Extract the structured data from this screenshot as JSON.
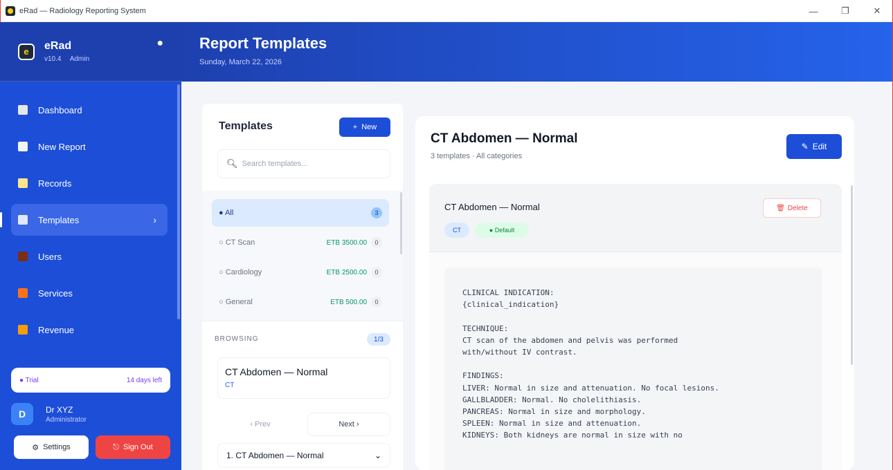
{
  "window": {
    "title": "eRad — Radiology Reporting System",
    "controls": {
      "minimize": "—",
      "maximize": "❐",
      "close": "✕"
    }
  },
  "sidebar": {
    "app_name": "eRad",
    "version": "v10.4",
    "role": "Admin",
    "items": [
      {
        "label": "Dashboard",
        "icon": "dashboard-icon",
        "color": "#e5e7eb"
      },
      {
        "label": "New Report",
        "icon": "new-report-icon",
        "color": "#f3f4f6"
      },
      {
        "label": "Records",
        "icon": "records-icon",
        "color": "#fde68a"
      },
      {
        "label": "Templates",
        "icon": "templates-icon",
        "color": "#e0e7ff",
        "active": true
      },
      {
        "label": "Users",
        "icon": "users-icon",
        "color": "#7c2d12"
      },
      {
        "label": "Services",
        "icon": "services-icon",
        "color": "#f97316"
      },
      {
        "label": "Revenue",
        "icon": "revenue-icon",
        "color": "#f59e0b"
      }
    ],
    "trial": {
      "label": "● Trial",
      "days": "14 days left"
    },
    "user": {
      "initial": "D",
      "name": "Dr XYZ",
      "role": "Administrator"
    },
    "settings_label": "Settings",
    "signout_label": "Sign Out"
  },
  "header": {
    "title": "Report Templates",
    "date": "Sunday, March 22, 2026"
  },
  "templates": {
    "title": "Templates",
    "new_label": "New",
    "search_placeholder": "Search templates...",
    "categories": [
      {
        "name": "All",
        "price": "",
        "count": "3",
        "active": true
      },
      {
        "name": "CT Scan",
        "price": "ETB 3500.00",
        "count": "0"
      },
      {
        "name": "Cardiology",
        "price": "ETB 2500.00",
        "count": "0"
      },
      {
        "name": "General",
        "price": "ETB 500.00",
        "count": "0"
      }
    ],
    "browsing_label": "BROWSING",
    "browsing_count": "1/3",
    "current": {
      "title": "CT Abdomen — Normal",
      "category": "CT"
    },
    "prev_label": "‹ Prev",
    "next_label": "Next ›",
    "selected_option": "1. CT Abdomen — Normal"
  },
  "detail": {
    "title": "CT Abdomen — Normal",
    "meta": "3 templates · All categories",
    "edit_label": "Edit",
    "card_title": "CT Abdomen — Normal",
    "delete_label": "Delete",
    "tags": [
      "CT",
      "● Default"
    ],
    "body": "CLINICAL INDICATION:\n{clinical_indication}\n\nTECHNIQUE:\nCT scan of the abdomen and pelvis was performed\nwith/without IV contrast.\n\nFINDINGS:\nLIVER: Normal in size and attenuation. No focal lesions.\nGALLBLADDER: Normal. No cholelithiasis.\nPANCREAS: Normal in size and morphology.\nSPLEEN: Normal in size and attenuation.\nKIDNEYS: Both kidneys are normal in size with no"
  }
}
